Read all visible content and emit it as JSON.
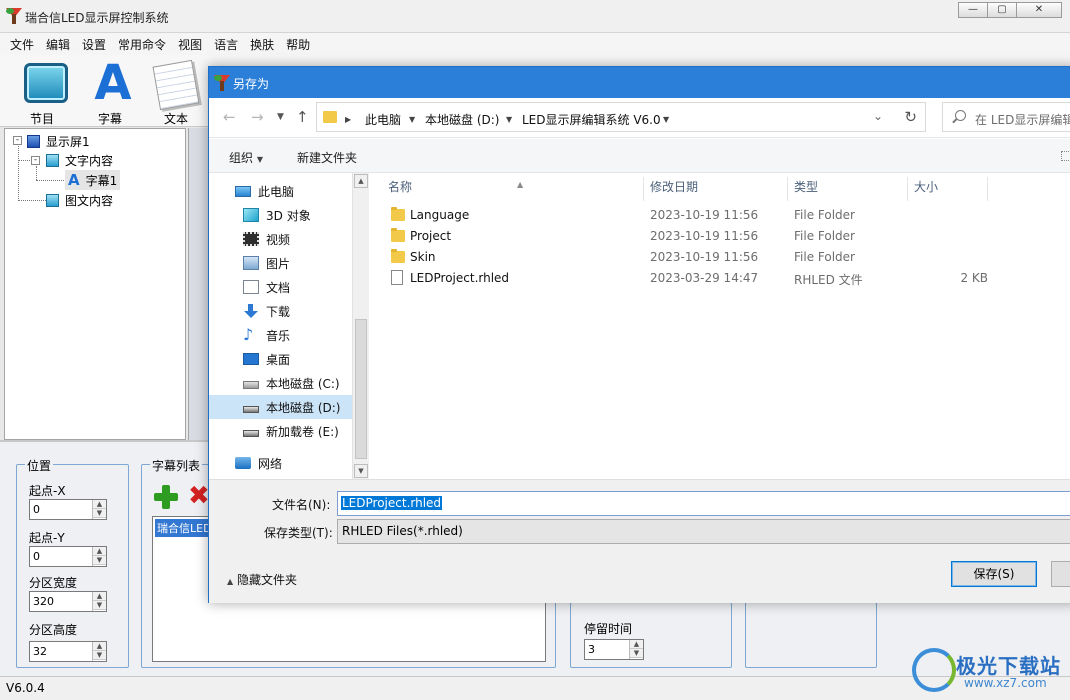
{
  "app": {
    "title": "瑞合信LED显示屏控制系统",
    "menu": [
      "文件",
      "编辑",
      "设置",
      "常用命令",
      "视图",
      "语言",
      "换肤",
      "帮助"
    ],
    "toolbar": [
      {
        "label": "节目",
        "icon": "program-icon"
      },
      {
        "label": "字幕",
        "icon": "subtitle-icon"
      },
      {
        "label": "文本",
        "icon": "text-icon"
      }
    ],
    "tree": {
      "root": "显示屏1",
      "children": [
        "文字内容",
        "字幕1",
        "图文内容"
      ]
    },
    "position_group": {
      "title": "位置",
      "fields": [
        {
          "label": "起点-X",
          "value": "0"
        },
        {
          "label": "起点-Y",
          "value": "0"
        },
        {
          "label": "分区宽度",
          "value": "320"
        },
        {
          "label": "分区高度",
          "value": "32"
        }
      ]
    },
    "subtitle_list": {
      "title": "字幕列表",
      "selected_item": "瑞合信LED"
    },
    "stay_time": {
      "label": "停留时间",
      "value": "3"
    },
    "status": {
      "version": "V6.0.4"
    },
    "watermark": {
      "main": "极光下载站",
      "sub": "www.xz7.com"
    }
  },
  "dialog": {
    "title": "另存为",
    "address": {
      "segments": [
        "此电脑",
        "本地磁盘 (D:)",
        "LED显示屏编辑系统 V6.0"
      ]
    },
    "search_placeholder": "在 LED显示屏编辑",
    "commands": {
      "organize": "组织",
      "new_folder": "新建文件夹"
    },
    "nav_items": [
      {
        "label": "此电脑",
        "icon": "this-pc-icon"
      },
      {
        "label": "3D 对象",
        "icon": "3d-objects-icon"
      },
      {
        "label": "视频",
        "icon": "video-icon"
      },
      {
        "label": "图片",
        "icon": "pictures-icon"
      },
      {
        "label": "文档",
        "icon": "documents-icon"
      },
      {
        "label": "下载",
        "icon": "downloads-icon"
      },
      {
        "label": "音乐",
        "icon": "music-icon"
      },
      {
        "label": "桌面",
        "icon": "desktop-icon"
      },
      {
        "label": "本地磁盘 (C:)",
        "icon": "drive-c-icon"
      },
      {
        "label": "本地磁盘 (D:)",
        "icon": "drive-d-icon",
        "selected": true
      },
      {
        "label": "新加载卷 (E:)",
        "icon": "drive-e-icon"
      },
      {
        "label": "网络",
        "icon": "network-icon"
      }
    ],
    "columns": [
      "名称",
      "修改日期",
      "类型",
      "大小"
    ],
    "files": [
      {
        "name": "Language",
        "date": "2023-10-19 11:56",
        "type": "File Folder",
        "size": "",
        "kind": "folder"
      },
      {
        "name": "Project",
        "date": "2023-10-19 11:56",
        "type": "File Folder",
        "size": "",
        "kind": "folder"
      },
      {
        "name": "Skin",
        "date": "2023-10-19 11:56",
        "type": "File Folder",
        "size": "",
        "kind": "folder"
      },
      {
        "name": "LEDProject.rhled",
        "date": "2023-03-29 14:47",
        "type": "RHLED 文件",
        "size": "2 KB",
        "kind": "file"
      }
    ],
    "filename_label": "文件名(N):",
    "filename_value": "LEDProject.rhled",
    "filetype_label": "保存类型(T):",
    "filetype_value": "RHLED Files(*.rhled)",
    "hide_folders": "隐藏文件夹",
    "save_button": "保存(S)"
  }
}
